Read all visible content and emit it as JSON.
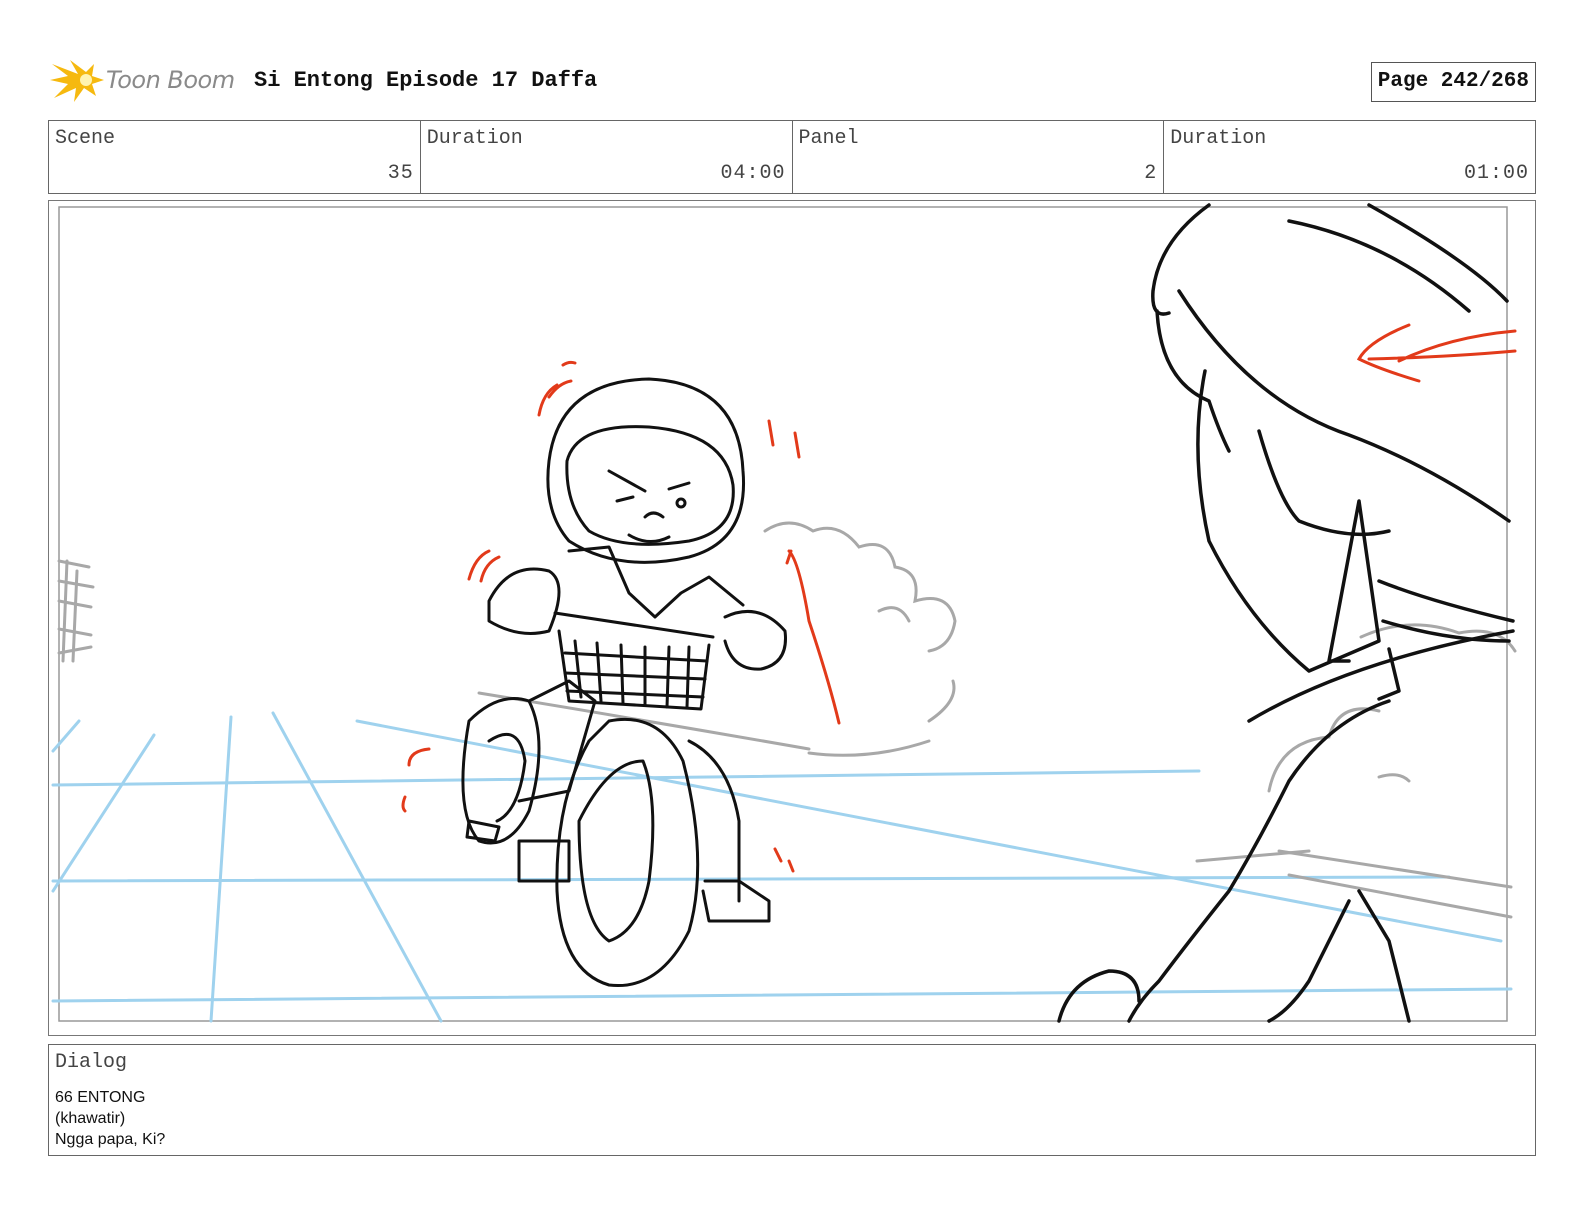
{
  "header": {
    "logo_text": "Toon Boom",
    "title": "Si Entong Episode 17 Daffa",
    "page": "Page 242/268"
  },
  "info": {
    "scene_label": "Scene",
    "scene_value": "35",
    "scene_duration_label": "Duration",
    "scene_duration_value": "04:00",
    "panel_label": "Panel",
    "panel_value": "2",
    "panel_duration_label": "Duration",
    "panel_duration_value": "01:00"
  },
  "dialog": {
    "label": "Dialog",
    "lines": [
      "66 ENTONG",
      "(khawatir)",
      "Ngga papa, Ki?"
    ]
  },
  "colors": {
    "guide_blue": "#9fd2ee",
    "action_red": "#e23a1a",
    "logo_yellow": "#f6b90f"
  }
}
